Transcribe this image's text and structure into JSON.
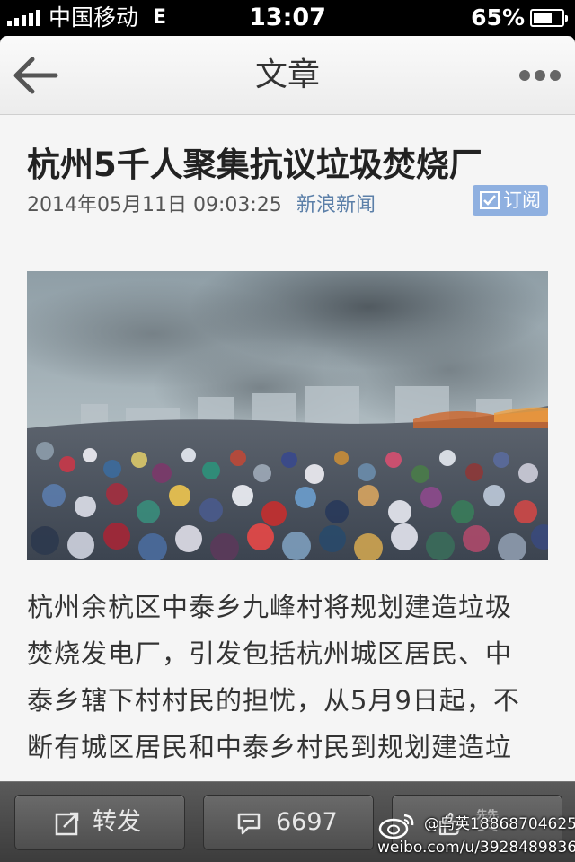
{
  "status_bar": {
    "carrier": "中国移动",
    "network": "E",
    "time": "13:07",
    "battery_percent": "65%",
    "battery_level": 0.65
  },
  "nav": {
    "title": "文章",
    "back_icon": "back-arrow-icon",
    "more_icon": "more-dots-icon"
  },
  "article": {
    "headline": "杭州5千人聚集抗议垃圾焚烧厂",
    "date": "2014年05月11日 09:03:25",
    "source": "新浪新闻",
    "subscribe_label": "订阅",
    "body_lines": [
      "杭州余杭区中泰乡九峰村将规划建造垃圾",
      "焚烧发电厂，引发包括杭州城区居民、中",
      "泰乡辖下村村民的担忧，从5月9日起，不",
      "断有城区居民和中泰乡村民到规划建造垃"
    ]
  },
  "toolbar": {
    "share_label": "转发",
    "comment_count": "6697",
    "like_label": "赞"
  },
  "watermark": {
    "user": "@乌英18868704625",
    "url": "weibo.com/u/3928489836"
  },
  "colors": {
    "source_link": "#5b7fa8",
    "subscribe_bg": "#8fb0e0",
    "toolbar_bg": "#4a4a4a"
  }
}
